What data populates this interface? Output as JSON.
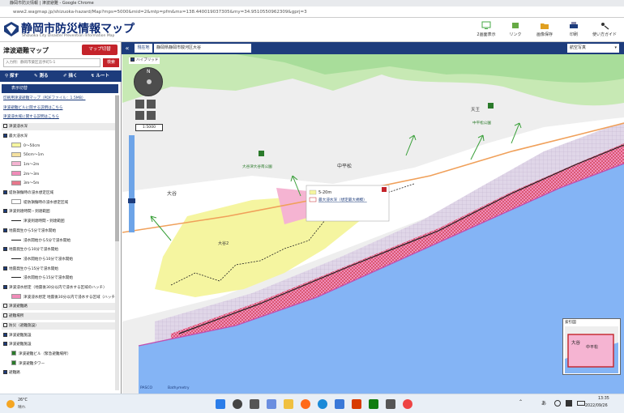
{
  "browser": {
    "window_title": "静岡市防災情報 | 津波避難 - Google Chrome",
    "url": "www2.wagmap.jp/shizuoka-hazard/Map?mps=5000&mid=2&mtp=pfm&mx=138.440019037305&my=34.9510550962309&gprj=3"
  },
  "header": {
    "title": "静岡市防災情報マップ",
    "subtitle": "Shizuoka City Disaster Prevention Information Map",
    "buttons": [
      "2画面表示",
      "リンク",
      "画像保存",
      "印刷",
      "使い方ガイド"
    ]
  },
  "panel": {
    "title": "津波避難マップ",
    "map_button": "マップ切替",
    "search_placeholder": "入力例：静岡市葵区追手町5-1",
    "search_button": "検索",
    "tools": [
      "探す",
      "測る",
      "描く",
      "ルート"
    ],
    "section_label": "表示切替",
    "layers": [
      {
        "label": "印刷用津波避難マップ（PDFファイル：1.5MB）",
        "type": "link"
      },
      {
        "label": "津波避難ビルに関する説明はこちら",
        "type": "link"
      },
      {
        "label": "津波浸水域に関する説明はこちら",
        "type": "link"
      },
      {
        "label": "津波浸水深",
        "type": "group"
      },
      {
        "label": "最大浸水深",
        "type": "check"
      },
      {
        "label": "0～50cm",
        "type": "legend",
        "color": "#f5f5a0"
      },
      {
        "label": "50cm～1m",
        "type": "legend",
        "color": "#f5e1a0"
      },
      {
        "label": "1m～2m",
        "type": "legend",
        "color": "#f5b4d2"
      },
      {
        "label": "2m～3m",
        "type": "legend",
        "color": "#f08cb9"
      },
      {
        "label": "3m～5m",
        "type": "legend",
        "color": "#e6788c"
      },
      {
        "label": "堤防損傷時の浸水想定区域",
        "type": "check"
      },
      {
        "label": "堤防損傷時の浸水想定区域",
        "type": "legend",
        "color": "#ffffff"
      },
      {
        "label": "津波到達時間・到達範囲",
        "type": "check"
      },
      {
        "label": "津波到達時間・到達範囲",
        "type": "line"
      },
      {
        "label": "地震発生から5分で浸水開始",
        "type": "check"
      },
      {
        "label": "浸水開始から5分で浸水開始",
        "type": "line"
      },
      {
        "label": "地震発生から10分で浸水開始",
        "type": "check"
      },
      {
        "label": "浸水開始から10分で浸水開始",
        "type": "line"
      },
      {
        "label": "地震発生から15分で浸水開始",
        "type": "check"
      },
      {
        "label": "浸水開始から15分で浸水開始",
        "type": "line"
      },
      {
        "label": "津波浸水想定（地震後30分以内で浸水する区域のハッチ）",
        "type": "check"
      },
      {
        "label": "津波浸水想定 地震後30分以内で浸水する区域（ハッチ）",
        "type": "hatch"
      },
      {
        "label": "津波避難路",
        "type": "group"
      },
      {
        "label": "避難場所",
        "type": "group"
      },
      {
        "label": "防災（避難施設）",
        "type": "group"
      },
      {
        "label": "津波避難施設",
        "type": "check"
      },
      {
        "label": "津波避難施設",
        "type": "check"
      },
      {
        "label": "津波避難ビル（緊急避難場所）",
        "type": "icon"
      },
      {
        "label": "津波避難タワー",
        "type": "icon"
      },
      {
        "label": "避難路",
        "type": "check"
      }
    ]
  },
  "map": {
    "location_label": "現在地",
    "address": "静岡県静岡市駿河区大谷",
    "layer_select": "航空写真",
    "overview_label": "索引図",
    "layer_toggle": "ハイブリッド",
    "scale": "1:5000",
    "places": [
      "大谷",
      "大谷2",
      "中平松",
      "天王",
      "大谷津大谷南公園",
      "中平松公園",
      "大谷"
    ],
    "popup": {
      "value": "5-20m",
      "text": "最大浸水深（想定最大規模）"
    },
    "overview_places": [
      "大谷",
      "中平松"
    ],
    "credits": [
      "PASCO",
      "Bathymetry"
    ]
  },
  "taskbar": {
    "weather_temp": "26°C",
    "weather_text": "晴れ",
    "time": "13:35",
    "date": "2022/09/26",
    "ime": "あ"
  }
}
